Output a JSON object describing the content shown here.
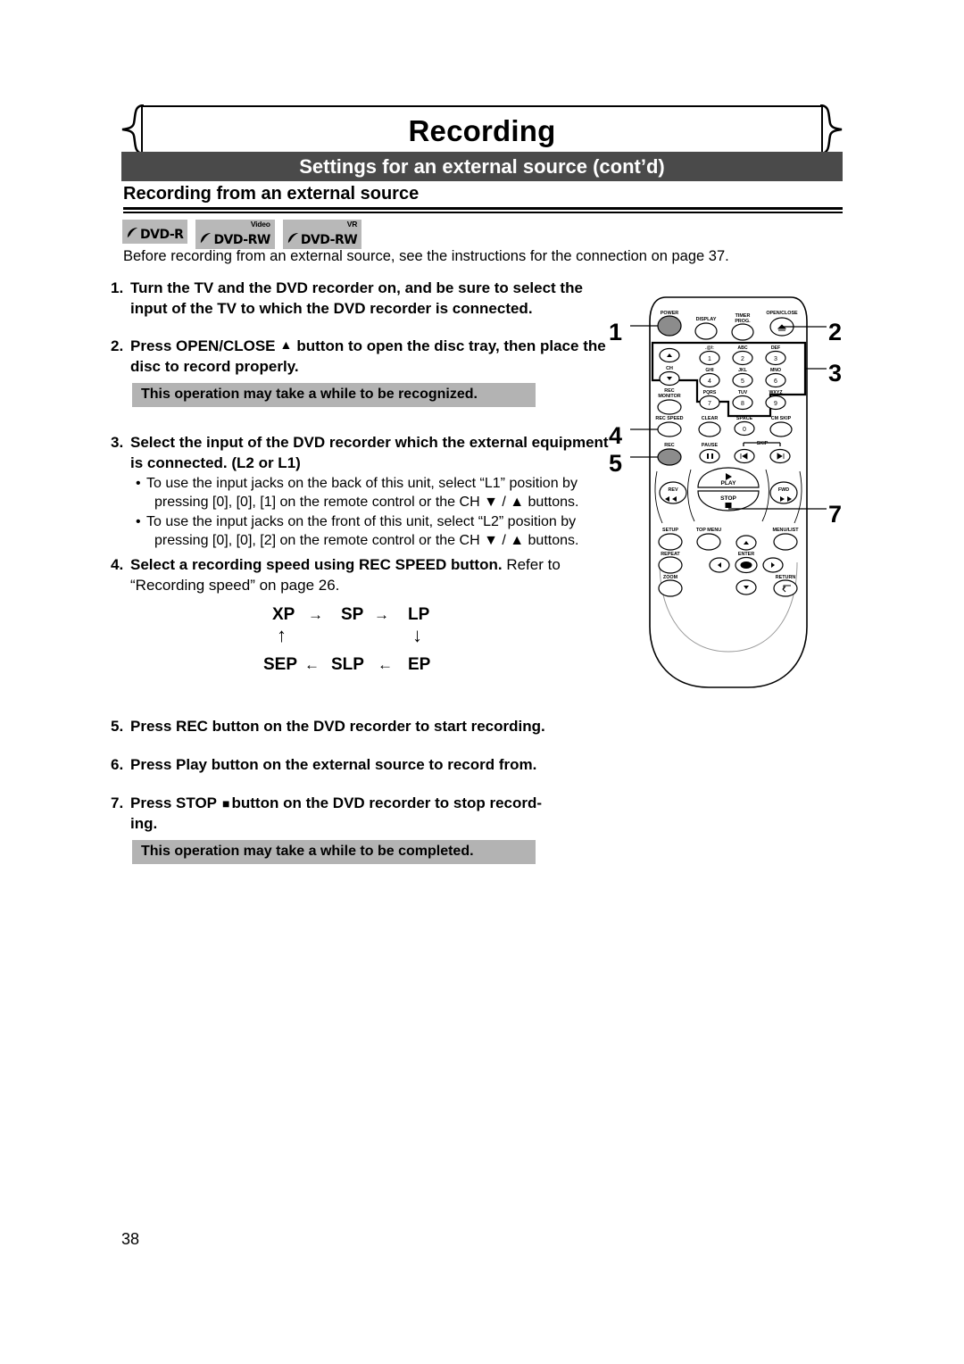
{
  "page": {
    "title": "Recording",
    "section_banner": "Settings for an external source (cont’d)",
    "subheading": "Recording from an external source",
    "intro": "Before recording from an external source, see the instructions for the connection on page 37.",
    "page_number": "38"
  },
  "badges": [
    {
      "name": "dvd-r",
      "label": "DVD-R",
      "superscript": ""
    },
    {
      "name": "dvd-rw-video",
      "label": "DVD-RW",
      "superscript": "Video"
    },
    {
      "name": "dvd-rw-vr",
      "label": "DVD-RW",
      "superscript": "VR"
    }
  ],
  "steps": {
    "s1_num": "1.",
    "s1_text": "Turn the TV and the DVD recorder on, and be sure to select the input of the TV to which the DVD recorder is connected.",
    "s2_num": "2.",
    "s2_a": "Press OPEN/CLOSE",
    "s2_icon": "▲",
    "s2_b": "button to open the disc tray, then place the disc to record properly.",
    "note1": "This operation may take a while to be recognized.",
    "s3_num": "3.",
    "s3_text": "Select the input of the DVD recorder which the external equipment is connected. (L2 or L1)",
    "bullet1_a": "To use the input jacks on the back of this unit, select “L1” position by",
    "bullet1_b": "pressing [0], [0], [1] on the remote control or the CH ▼ / ▲ buttons.",
    "bullet2_a": "To use the input jacks on the front of this unit, select “L2” position by",
    "bullet2_b": "pressing [0], [0], [2] on the remote control or the CH ▼ / ▲ buttons.",
    "s4_num": "4.",
    "s4_bold": "Select a recording speed using REC SPEED button.",
    "s4_reg": "Refer to “Recording speed” on page 26.",
    "s5_num": "5.",
    "s5_text": "Press REC button on the DVD recorder to start recording.",
    "s6_num": "6.",
    "s6_text": "Press Play button on the external source to record from.",
    "s7_num": "7.",
    "s7_a": "Press STOP",
    "s7_icon": "■",
    "s7_b": "button on the DVD recorder to stop record-",
    "s7_c": "ing.",
    "note2": "This operation may take a while to be completed."
  },
  "speed_cycle": {
    "xp": "XP",
    "sp": "SP",
    "lp": "LP",
    "ep": "EP",
    "slp": "SLP",
    "sep": "SEP",
    "arrow_right": "→",
    "arrow_left": "←",
    "arrow_up": "↑",
    "arrow_down": "↓"
  },
  "remote": {
    "labels": {
      "power": "POWER",
      "display": "DISPLAY",
      "timer_prog": "TIMER\nPROG.",
      "timer_prog_1": "TIMER",
      "timer_prog_2": "PROG.",
      "open_close": "OPEN/CLOSE",
      "ch": "CH",
      "rec_monitor_1": "REC",
      "rec_monitor_2": "MONITOR",
      "rec_speed": "REC SPEED",
      "clear": "CLEAR",
      "space": "SPACE",
      "cm_skip": "CM SKIP",
      "rec": "REC",
      "pause": "PAUSE",
      "skip": "SKIP",
      "play": "PLAY",
      "stop": "STOP",
      "rev": "REV",
      "fwd": "FWD",
      "setup": "SETUP",
      "top_menu": "TOP MENU",
      "menu_list": "MENU/LIST",
      "repeat": "REPEAT",
      "enter": "ENTER",
      "zoom": "ZOOM",
      "return": "RETURN"
    },
    "keypad": [
      {
        "digit": "1",
        "letters": ".@/:"
      },
      {
        "digit": "2",
        "letters": "ABC"
      },
      {
        "digit": "3",
        "letters": "DEF"
      },
      {
        "digit": "4",
        "letters": "GHI"
      },
      {
        "digit": "5",
        "letters": "JKL"
      },
      {
        "digit": "6",
        "letters": "MNO"
      },
      {
        "digit": "7",
        "letters": "PQRS"
      },
      {
        "digit": "8",
        "letters": "TUV"
      },
      {
        "digit": "9",
        "letters": "WXYZ"
      },
      {
        "digit": "0",
        "letters": ""
      }
    ],
    "callouts": {
      "c1": "1",
      "c2": "2",
      "c3": "3",
      "c4": "4",
      "c5": "5",
      "c7": "7"
    }
  },
  "colors": {
    "banner_bg": "#4a4a4a",
    "note_bg": "#b3b3b3",
    "badge_bg": "#b8b8b8",
    "highlight_button": "#8c8c8c"
  }
}
